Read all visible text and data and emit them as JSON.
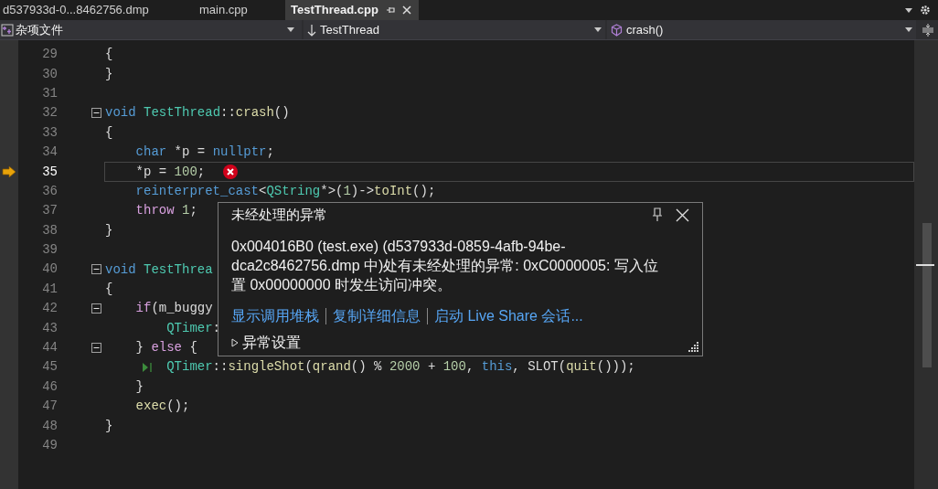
{
  "tabs": [
    {
      "label": "d537933d-0...8462756.dmp",
      "selected": false
    },
    {
      "label": "main.cpp",
      "selected": false
    },
    {
      "label": "TestThread.cpp",
      "selected": true
    }
  ],
  "nav_bar": {
    "project": "杂项文件",
    "scope": "TestThread",
    "member": "crash()"
  },
  "lines": [
    {
      "number": "29",
      "current": false,
      "fold": false,
      "tokens": [
        {
          "kind": "plain",
          "text": "{"
        }
      ]
    },
    {
      "number": "30",
      "current": false,
      "fold": false,
      "tokens": [
        {
          "kind": "plain",
          "text": "}"
        }
      ]
    },
    {
      "number": "31",
      "current": false,
      "fold": false
    },
    {
      "number": "32",
      "current": false,
      "fold": true,
      "tokens": [
        {
          "kind": "kw",
          "text": "void "
        },
        {
          "kind": "type",
          "text": "TestThread"
        },
        {
          "kind": "plain",
          "text": "::"
        },
        {
          "kind": "fn",
          "text": "crash"
        },
        {
          "kind": "plain",
          "text": "()"
        }
      ]
    },
    {
      "number": "33",
      "current": false,
      "fold": false,
      "tokens": [
        {
          "kind": "plain",
          "text": "{"
        }
      ]
    },
    {
      "number": "34",
      "current": false,
      "fold": false,
      "tokens": [
        {
          "kind": "kw",
          "text": "    char"
        },
        {
          "kind": "plain",
          "text": " *p = "
        },
        {
          "kind": "kw",
          "text": "nullptr"
        },
        {
          "kind": "plain",
          "text": ";"
        }
      ]
    },
    {
      "number": "35",
      "current": true,
      "fold": false,
      "error": true,
      "tokens": [
        {
          "kind": "plain",
          "text": "    *p = "
        },
        {
          "kind": "num",
          "text": "100"
        },
        {
          "kind": "plain",
          "text": ";"
        }
      ]
    },
    {
      "number": "36",
      "current": false,
      "fold": false,
      "tokens": [
        {
          "kind": "kw",
          "text": "    reinterpret_cast"
        },
        {
          "kind": "plain",
          "text": "<"
        },
        {
          "kind": "type",
          "text": "QString"
        },
        {
          "kind": "plain",
          "text": "*>("
        },
        {
          "kind": "num",
          "text": "1"
        },
        {
          "kind": "plain",
          "text": ")->"
        },
        {
          "kind": "fn",
          "text": "toInt"
        },
        {
          "kind": "plain",
          "text": "();"
        }
      ]
    },
    {
      "number": "37",
      "current": false,
      "fold": false,
      "tokens": [
        {
          "kind": "ctl",
          "text": "    throw "
        },
        {
          "kind": "num",
          "text": "1"
        },
        {
          "kind": "plain",
          "text": ";"
        }
      ]
    },
    {
      "number": "38",
      "current": false,
      "fold": false,
      "tokens": [
        {
          "kind": "plain",
          "text": "}"
        }
      ]
    },
    {
      "number": "39",
      "current": false,
      "fold": false
    },
    {
      "number": "40",
      "current": false,
      "fold": true,
      "tokens": [
        {
          "kind": "kw",
          "text": "void "
        },
        {
          "kind": "type",
          "text": "TestThrea"
        }
      ]
    },
    {
      "number": "41",
      "current": false,
      "fold": false,
      "tokens": [
        {
          "kind": "plain",
          "text": "{"
        }
      ]
    },
    {
      "number": "42",
      "current": false,
      "fold": true,
      "tokens": [
        {
          "kind": "ctl",
          "text": "    if"
        },
        {
          "kind": "plain",
          "text": "(m_buggy"
        }
      ]
    },
    {
      "number": "43",
      "current": false,
      "fold": false,
      "tokens": [
        {
          "kind": "type",
          "text": "        QTimer"
        },
        {
          "kind": "plain",
          "text": ":"
        }
      ]
    },
    {
      "number": "44",
      "current": false,
      "fold": true,
      "tokens": [
        {
          "kind": "plain",
          "text": "    } "
        },
        {
          "kind": "ctl",
          "text": "else"
        },
        {
          "kind": "plain",
          "text": " {"
        }
      ]
    },
    {
      "number": "45",
      "current": false,
      "fold": false,
      "run_marker": true,
      "tokens": [
        {
          "kind": "type",
          "text": "        QTimer"
        },
        {
          "kind": "plain",
          "text": "::"
        },
        {
          "kind": "fn",
          "text": "singleShot"
        },
        {
          "kind": "plain",
          "text": "("
        },
        {
          "kind": "fn",
          "text": "qrand"
        },
        {
          "kind": "plain",
          "text": "() % "
        },
        {
          "kind": "num",
          "text": "2000"
        },
        {
          "kind": "plain",
          "text": " + "
        },
        {
          "kind": "num",
          "text": "100"
        },
        {
          "kind": "plain",
          "text": ", "
        },
        {
          "kind": "kw",
          "text": "this"
        },
        {
          "kind": "plain",
          "text": ", SLOT("
        },
        {
          "kind": "fn",
          "text": "quit"
        },
        {
          "kind": "plain",
          "text": "()));"
        }
      ]
    },
    {
      "number": "46",
      "current": false,
      "fold": false,
      "tokens": [
        {
          "kind": "plain",
          "text": "    }"
        }
      ]
    },
    {
      "number": "47",
      "current": false,
      "fold": false,
      "tokens": [
        {
          "kind": "fn",
          "text": "    exec"
        },
        {
          "kind": "plain",
          "text": "();"
        }
      ]
    },
    {
      "number": "48",
      "current": false,
      "fold": false,
      "tokens": [
        {
          "kind": "plain",
          "text": "}"
        }
      ]
    },
    {
      "number": "49",
      "current": false,
      "fold": false
    }
  ],
  "exception_popup": {
    "title": "未经处理的异常",
    "message": "0x004016B0 (test.exe) (d537933d-0859-4afb-94be-dca2c8462756.dmp 中)处有未经处理的异常: 0xC0000005: 写入位置 0x00000000 时发生访问冲突。",
    "links": [
      "显示调用堆栈",
      "复制详细信息",
      "启动 Live Share 会话..."
    ],
    "settings": {
      "label": "异常设置",
      "expanded": false
    }
  }
}
